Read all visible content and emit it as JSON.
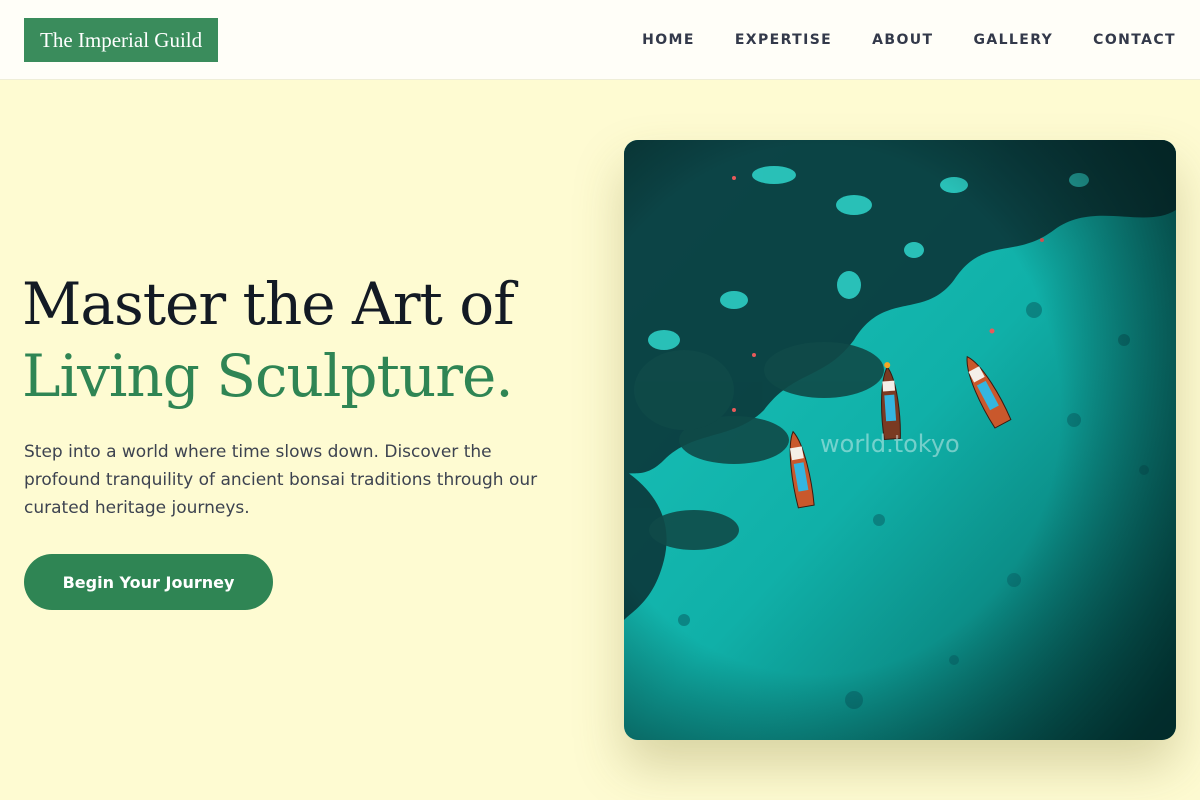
{
  "brand": {
    "name": "The Imperial Guild",
    "color": "#3a8c5c"
  },
  "nav": {
    "items": [
      {
        "label": "HOME"
      },
      {
        "label": "EXPERTISE"
      },
      {
        "label": "ABOUT"
      },
      {
        "label": "GALLERY"
      },
      {
        "label": "CONTACT"
      }
    ]
  },
  "hero": {
    "title_line1": "Master the Art of",
    "title_line2": "Living Sculpture.",
    "description": "Step into a world where time slows down. Discover the profound tranquility of ancient bonsai traditions through our curated heritage journeys.",
    "cta_label": "Begin Your Journey",
    "image": {
      "watermark": "world.tokyo"
    }
  },
  "colors": {
    "background": "#fefbd2",
    "header_background": "#fffef8",
    "accent": "#2f8554",
    "heading": "#131a24",
    "body_text": "#3d4350",
    "water": "#10b3aa"
  }
}
